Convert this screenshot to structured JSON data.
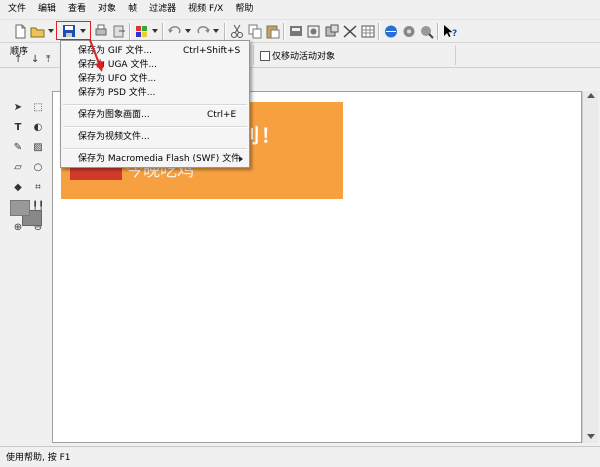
{
  "menubar": [
    "文件",
    "编辑",
    "查看",
    "对象",
    "帧",
    "过滤器",
    "视频 F/X",
    "帮助"
  ],
  "row2": {
    "order_label": "顺序",
    "checkbox_label": "仅移动活动对象"
  },
  "dropdown": {
    "items": [
      {
        "label": "保存为 GIF 文件...",
        "shortcut": "Ctrl+Shift+S"
      },
      {
        "label": "保存为 UGA 文件...",
        "shortcut": ""
      },
      {
        "label": "保存为 UFO 文件...",
        "shortcut": ""
      },
      {
        "label": "保存为 PSD 文件...",
        "shortcut": ""
      },
      {
        "label": "保存为图象画面...",
        "shortcut": "Ctrl+E"
      },
      {
        "label": "保存为视频文件...",
        "shortcut": ""
      },
      {
        "label": "保存为 Macromedia Flash (SWF) 文件",
        "shortcut": ""
      }
    ]
  },
  "canvas": {
    "banner_title": "吉大利！",
    "banner_sub": "今晚吃鸡",
    "banner_color": "#f6a040"
  },
  "status": {
    "text": "使用帮助, 按 F1"
  },
  "colors": {
    "highlight": "#e02020",
    "accent": "#1b4fb8"
  }
}
